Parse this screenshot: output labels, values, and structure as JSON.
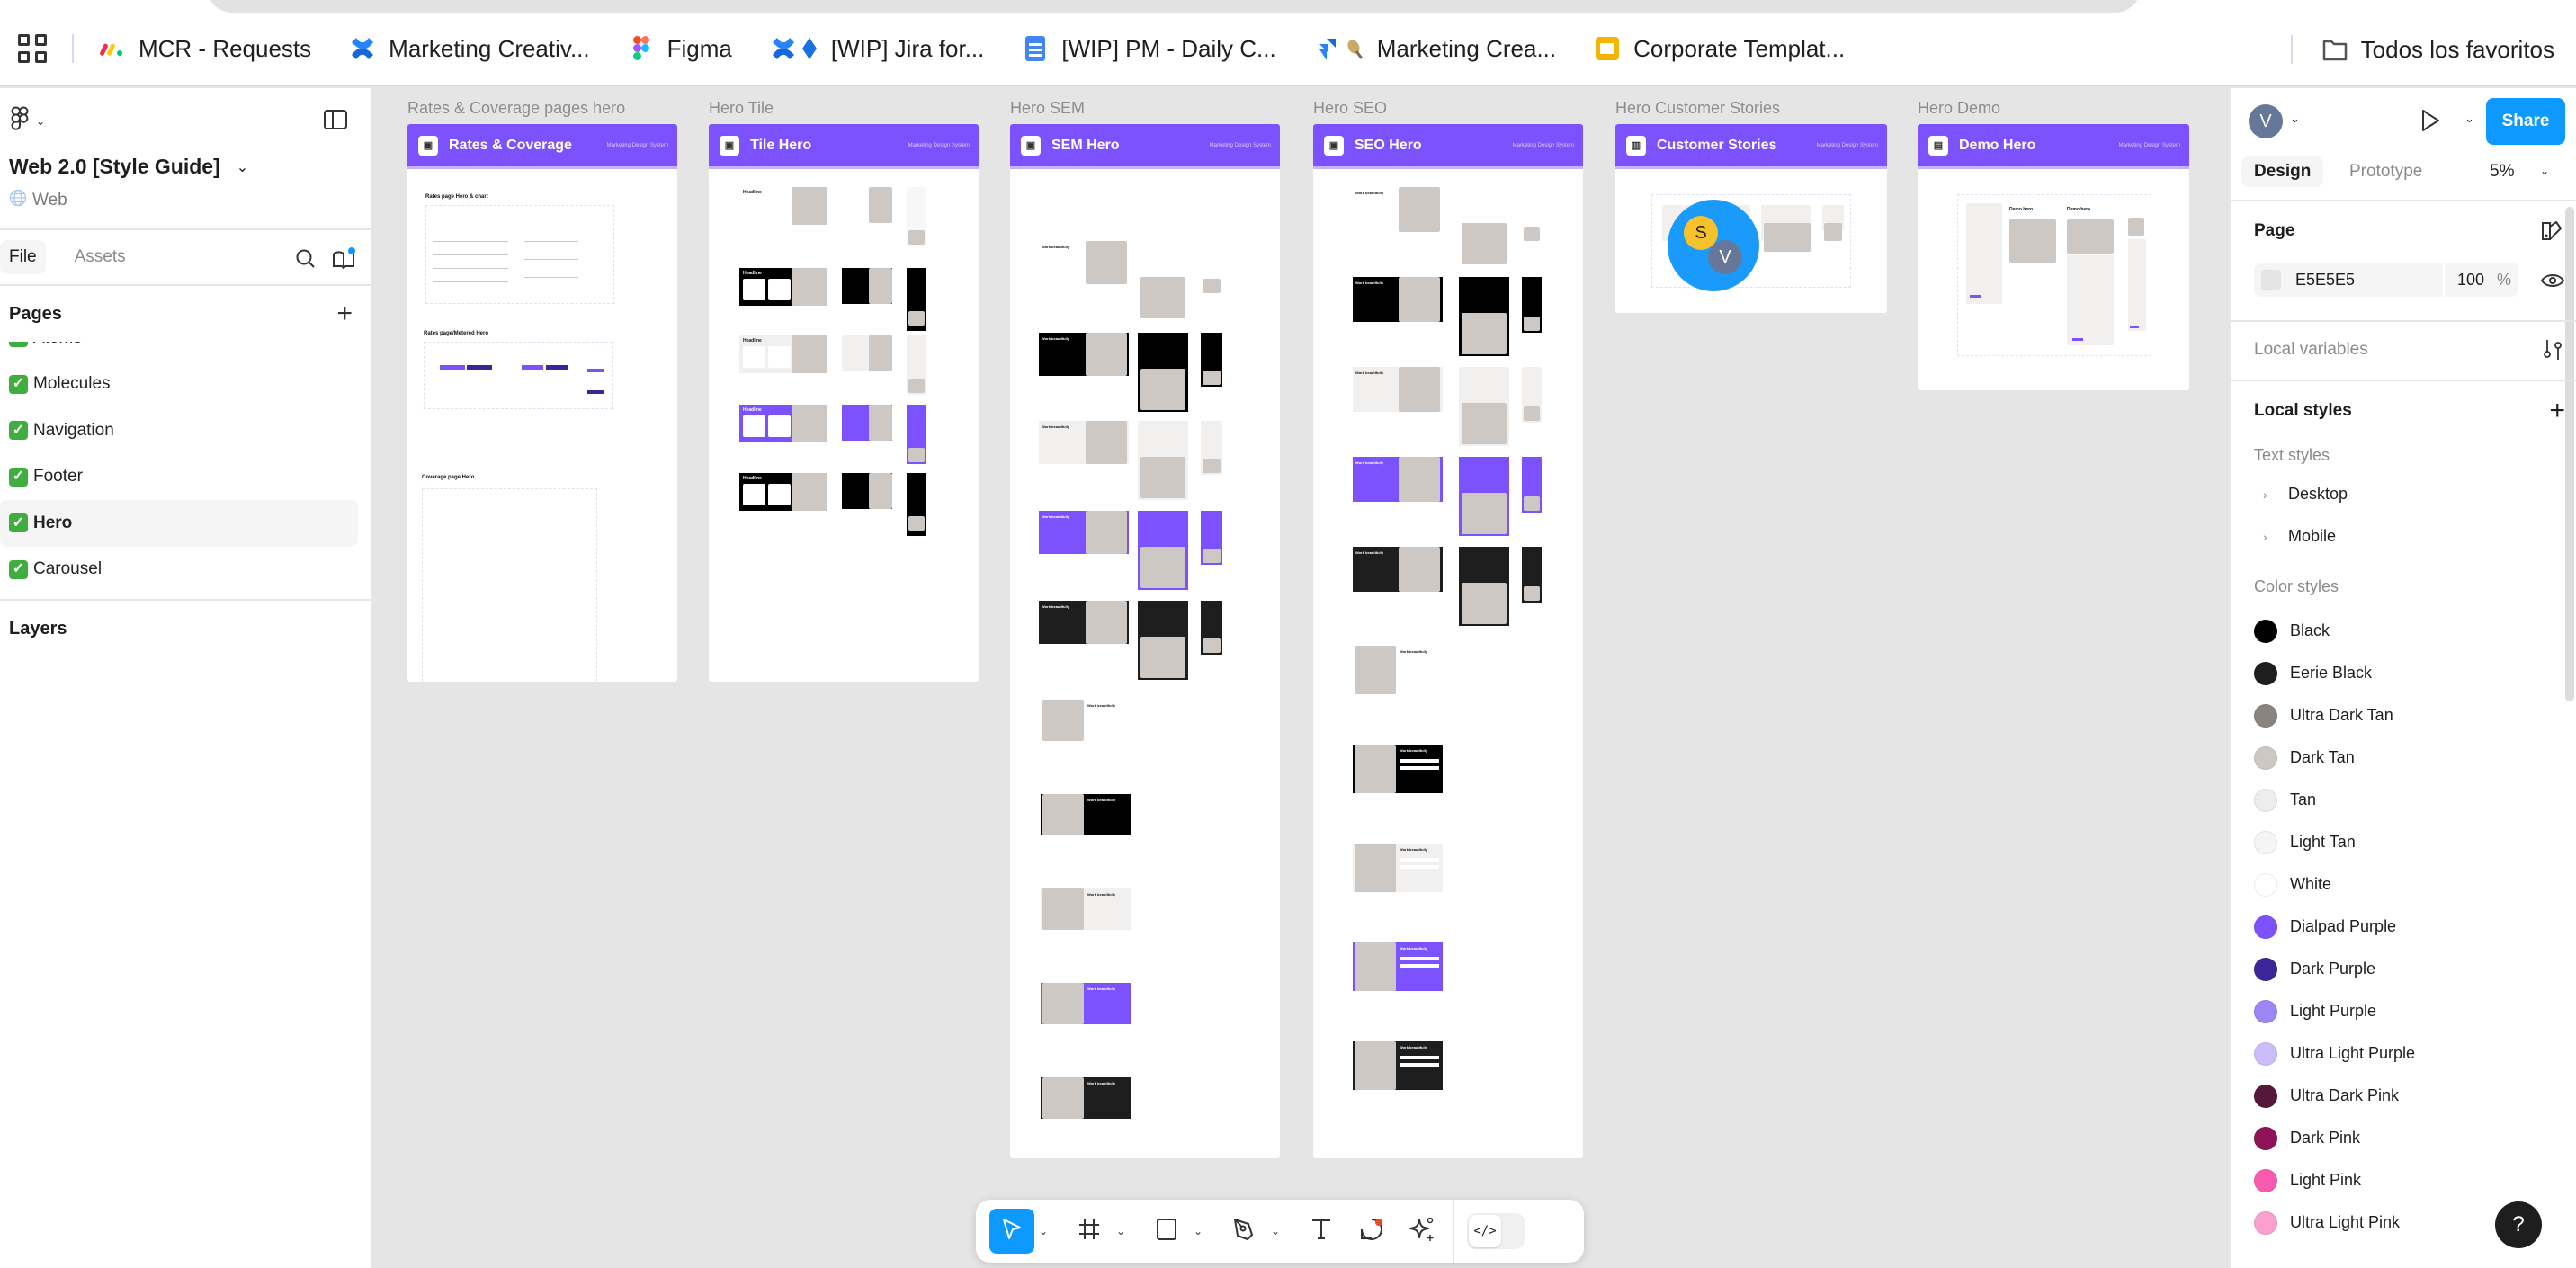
{
  "browser": {
    "bookmarks": [
      {
        "label": "MCR - Requests",
        "icon": "monday-icon"
      },
      {
        "label": "Marketing Creativ...",
        "icon": "confluence-icon"
      },
      {
        "label": "Figma",
        "icon": "figma-icon"
      },
      {
        "label": "[WIP] Jira for...",
        "icon": "confluence-jira-icon"
      },
      {
        "label": "[WIP] PM - Daily C...",
        "icon": "google-docs-icon"
      },
      {
        "label": "Marketing Crea...",
        "icon": "jira-icon"
      },
      {
        "label": "Corporate Templat...",
        "icon": "google-slides-icon"
      }
    ],
    "all_bookmarks_label": "Todos los favoritos"
  },
  "left_panel": {
    "file_name": "Web 2.0 [Style Guide]",
    "team": "Web",
    "tabs": {
      "file": "File",
      "assets": "Assets"
    },
    "pages_title": "Pages",
    "pages": [
      {
        "label": "Atoms",
        "check": "✓"
      },
      {
        "label": "Molecules",
        "check": "✓"
      },
      {
        "label": "Navigation",
        "check": "✓"
      },
      {
        "label": "Footer",
        "check": "✓"
      },
      {
        "label": "Hero",
        "check": "✓",
        "active": true
      },
      {
        "label": "Carousel",
        "check": "✓"
      }
    ],
    "layers_title": "Layers"
  },
  "canvas": {
    "frames": [
      {
        "label": "Rates & Coverage pages hero",
        "title": "Rates & Coverage",
        "subtitle": "Marketing Design System",
        "sections": [
          "Rates page Hero & chart",
          "Rates page/Metered Hero",
          "Coverage page Hero"
        ]
      },
      {
        "label": "Hero Tile",
        "title": "Tile Hero",
        "subtitle": "Marketing Design System",
        "sample_text": "Headline"
      },
      {
        "label": "Hero SEM",
        "title": "SEM Hero",
        "subtitle": "Marketing Design System",
        "sample_text": "Work beautifully"
      },
      {
        "label": "Hero SEO",
        "title": "SEO Hero",
        "subtitle": "Marketing Design System",
        "sample_text": "Work beautifully"
      },
      {
        "label": "Hero Customer Stories",
        "title": "Customer Stories",
        "subtitle": "Marketing Design System"
      },
      {
        "label": "Hero Demo",
        "title": "Demo Hero",
        "subtitle": "Marketing Design System",
        "sample_text": "Demo hero"
      }
    ],
    "collaborators": [
      {
        "initial": "S",
        "color": "#f6c12b"
      },
      {
        "initial": "V",
        "color": "#667799"
      }
    ]
  },
  "toolbar": {
    "tools": [
      "move",
      "frame",
      "rectangle",
      "pen",
      "text",
      "comment",
      "actions"
    ],
    "active_tool": "move",
    "dev_mode_label": "</>"
  },
  "right_panel": {
    "user_initial": "V",
    "share_label": "Share",
    "tabs": {
      "design": "Design",
      "prototype": "Prototype"
    },
    "zoom": "5%",
    "page_section": {
      "title": "Page",
      "bg_hex": "E5E5E5",
      "opacity": "100",
      "pct": "%"
    },
    "local_variables": "Local variables",
    "local_styles": "Local styles",
    "text_styles_title": "Text styles",
    "text_styles": [
      "Desktop",
      "Mobile"
    ],
    "color_styles_title": "Color styles",
    "color_styles": [
      {
        "name": "Black",
        "color": "#000000"
      },
      {
        "name": "Eerie Black",
        "color": "#1e1e1e"
      },
      {
        "name": "Ultra Dark Tan",
        "color": "#8a8480"
      },
      {
        "name": "Dark Tan",
        "color": "#cdc8c3"
      },
      {
        "name": "Tan",
        "color": "#ededed"
      },
      {
        "name": "Light Tan",
        "color": "#f5f5f5"
      },
      {
        "name": "White",
        "color": "#ffffff"
      },
      {
        "name": "Dialpad Purple",
        "color": "#7c52ff"
      },
      {
        "name": "Dark Purple",
        "color": "#3b2599"
      },
      {
        "name": "Light Purple",
        "color": "#9c85f5"
      },
      {
        "name": "Ultra Light Purple",
        "color": "#cbbdf9"
      },
      {
        "name": "Ultra Dark Pink",
        "color": "#561838"
      },
      {
        "name": "Dark Pink",
        "color": "#8f1358"
      },
      {
        "name": "Light Pink",
        "color": "#f75bb0"
      },
      {
        "name": "Ultra Light Pink",
        "color": "#f9a0cf"
      }
    ],
    "help_label": "?"
  },
  "colors": {
    "accent": "#0d99ff",
    "brand_purple": "#7c52ff",
    "canvas_bg": "#e5e5e5"
  }
}
